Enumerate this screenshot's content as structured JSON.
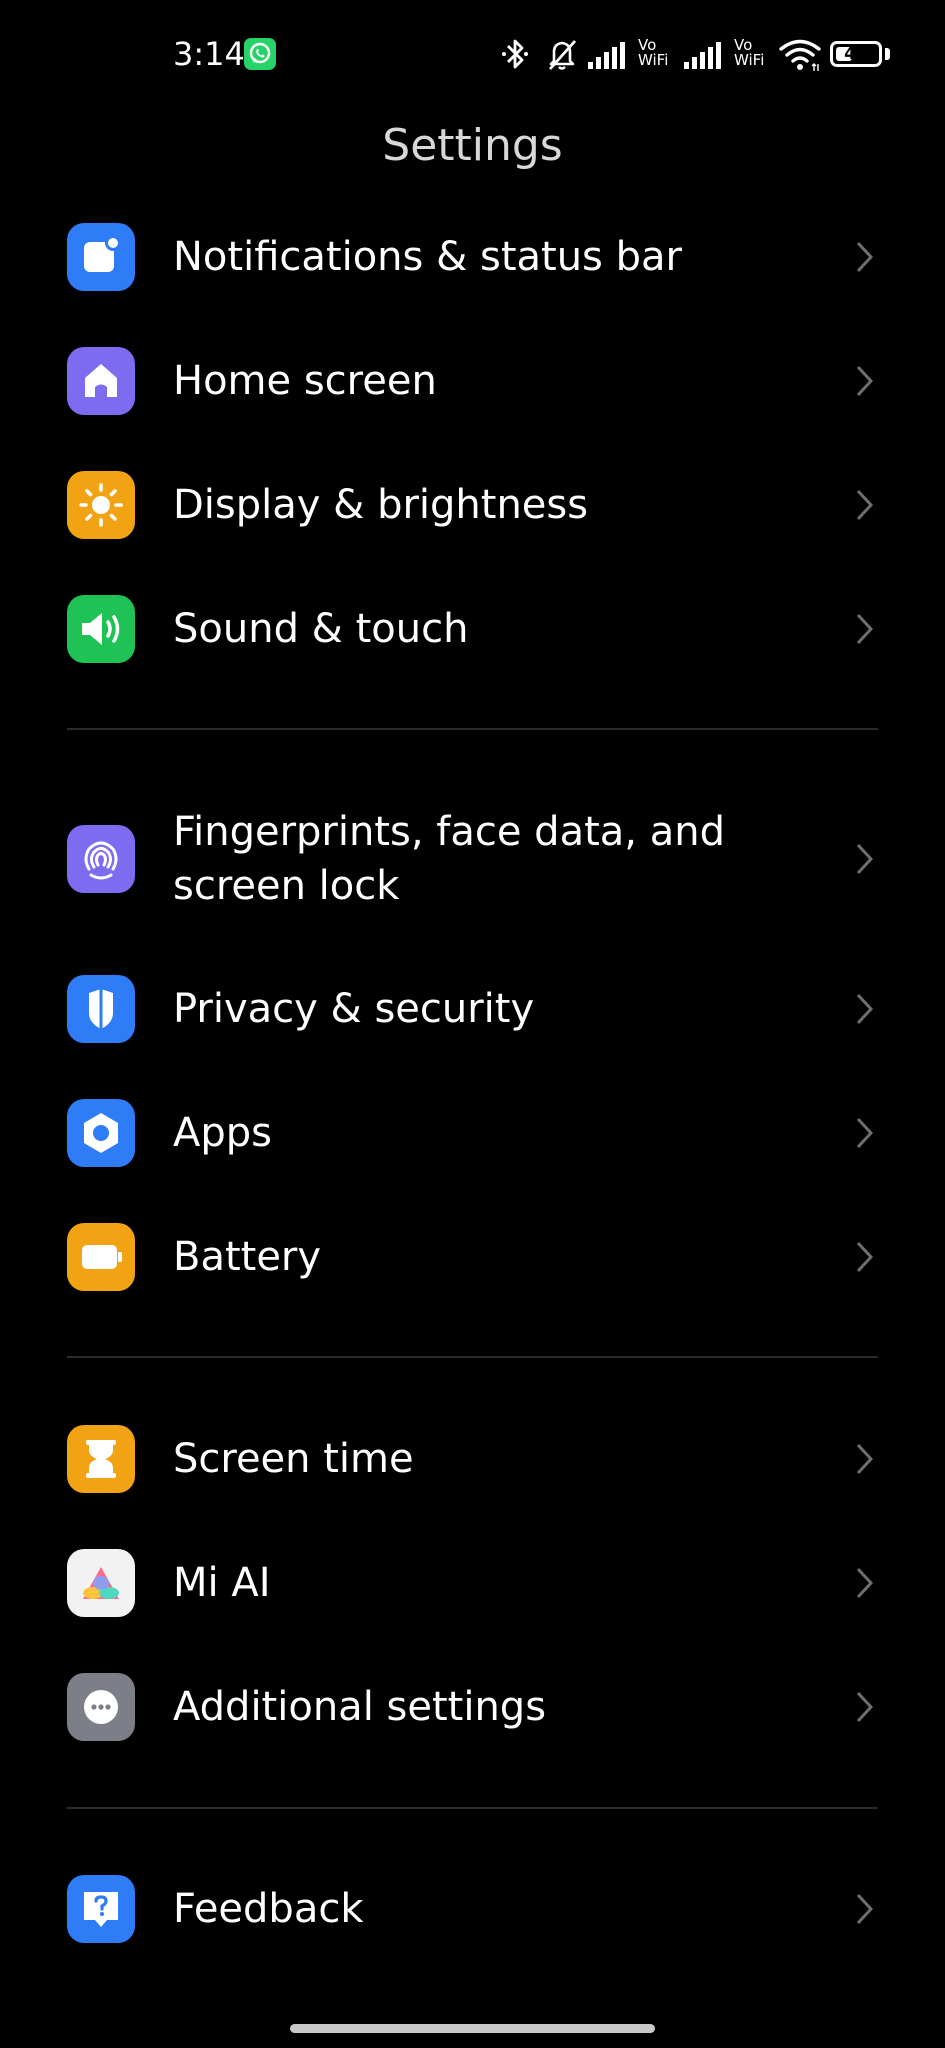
{
  "status_bar": {
    "time": "3:14",
    "notification_icon": "whatsapp-icon",
    "icons": [
      "bluetooth-icon",
      "bell-off-icon",
      "signal-icon",
      "vowifi-icon",
      "signal-icon",
      "vowifi-icon",
      "wifi-icon"
    ],
    "vowifi_label_1": "Vo\nWiFi",
    "vowifi_label_2": "Vo\nWiFi",
    "battery_level": "41",
    "battery_fraction": 0.41
  },
  "header": {
    "title": "Settings"
  },
  "groups": [
    {
      "items": [
        {
          "label": "Notifications & status bar",
          "icon": "notification-icon",
          "color": "#2e7cf6"
        },
        {
          "label": "Home screen",
          "icon": "home-icon",
          "color": "#7d6cf0"
        },
        {
          "label": "Display & brightness",
          "icon": "sun-icon",
          "color": "#f2a314"
        },
        {
          "label": "Sound & touch",
          "icon": "speaker-icon",
          "color": "#1fc254"
        }
      ]
    },
    {
      "items": [
        {
          "label": "Fingerprints, face data, and screen lock",
          "icon": "fingerprint-icon",
          "color": "#7d6cf0"
        },
        {
          "label": "Privacy & security",
          "icon": "shield-icon",
          "color": "#2e7cf6"
        },
        {
          "label": "Apps",
          "icon": "hexagon-icon",
          "color": "#2e7cf6"
        },
        {
          "label": "Battery",
          "icon": "battery-icon",
          "color": "#f2a314"
        }
      ]
    },
    {
      "items": [
        {
          "label": "Screen time",
          "icon": "hourglass-icon",
          "color": "#f2a314"
        },
        {
          "label": "Mi AI",
          "icon": "mi-ai-icon",
          "color": "#f2f2f2"
        },
        {
          "label": "Additional settings",
          "icon": "more-icon",
          "color": "#7c7e88"
        }
      ]
    },
    {
      "items": [
        {
          "label": "Feedback",
          "icon": "feedback-icon",
          "color": "#2e7cf6"
        }
      ]
    }
  ],
  "colors": {
    "background": "#000000",
    "text": "#ffffff",
    "title": "#d8d8d8",
    "chevron": "#6e6e6e",
    "divider": "#2a2a2a"
  }
}
